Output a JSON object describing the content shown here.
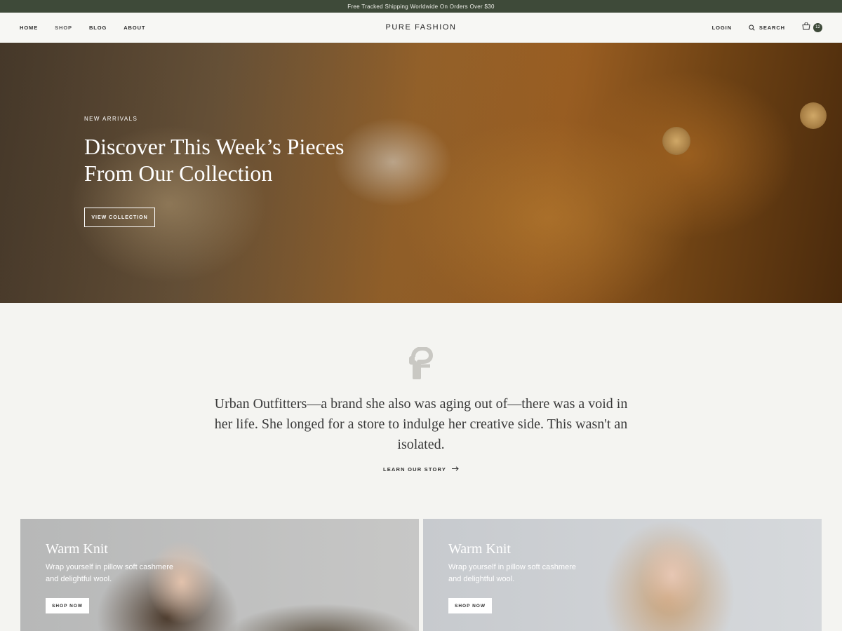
{
  "announcement": "Free Tracked Shipping Worldwide On Orders Over $30",
  "header": {
    "logo": "PURE FASHION",
    "nav": [
      {
        "label": "HOME"
      },
      {
        "label": "SHOP"
      },
      {
        "label": "BLOG"
      },
      {
        "label": "ABOUT"
      }
    ],
    "login": "LOGIN",
    "search": "SEARCH",
    "cart_count": "12"
  },
  "hero": {
    "eyebrow": "NEW ARRIVALS",
    "title": "Discover This Week’s Pieces From Our Collection",
    "cta": "VIEW COLLECTION"
  },
  "story": {
    "text": "Urban Outfitters—a brand she also was aging out of—there was a void in her life. She longed for a store to indulge her creative side. This wasn't an isolated.",
    "link": "LEARN OUR STORY",
    "link_icon": "arrow-right-icon"
  },
  "promos": [
    {
      "title": "Warm Knit",
      "desc": "Wrap yourself in pillow soft cashmere and delightful wool.",
      "cta": "SHOP NOW"
    },
    {
      "title": "Warm Knit",
      "desc": "Wrap yourself in pillow soft cashmere and delightful wool.",
      "cta": "SHOP NOW"
    }
  ],
  "colors": {
    "accent": "#3e4a39",
    "background": "#f4f4f1"
  }
}
